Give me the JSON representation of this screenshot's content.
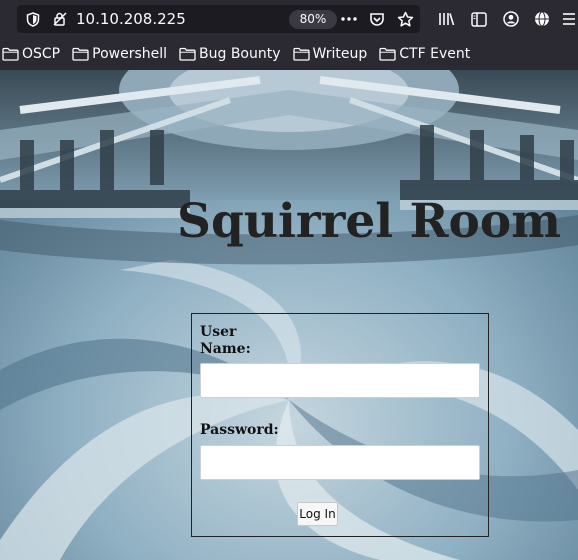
{
  "browser": {
    "url": "10.10.208.225",
    "zoom": "80%"
  },
  "bookmarks": [
    {
      "label": "OSCP"
    },
    {
      "label": "Powershell"
    },
    {
      "label": "Bug Bounty"
    },
    {
      "label": "Writeup"
    },
    {
      "label": "CTF Event"
    }
  ],
  "page": {
    "title": "Squirrel Room",
    "form": {
      "username_label": "User Name:",
      "username_value": "",
      "password_label": "Password:",
      "password_value": "",
      "login_button": "Log In"
    }
  },
  "colors": {
    "toolbar_bg": "#2b2a33",
    "urlbar_bg": "#1c1b22",
    "page_bg": "#6f93a9"
  }
}
